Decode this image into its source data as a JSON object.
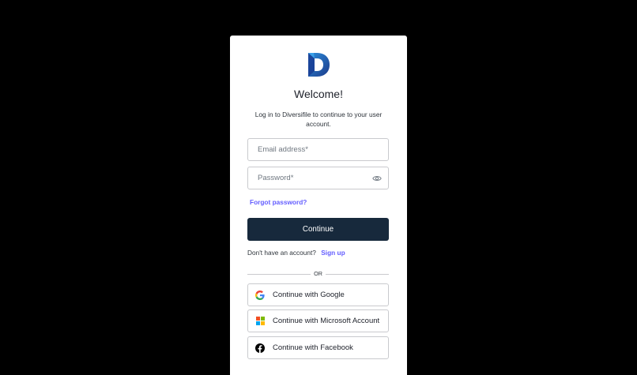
{
  "login": {
    "title": "Welcome!",
    "subtitle": "Log in to Diversifile to continue to your user account.",
    "email_placeholder": "Email address*",
    "password_placeholder": "Password*",
    "forgot_label": "Forgot password?",
    "continue_label": "Continue",
    "no_account_text": "Don't have an account?",
    "signup_label": "Sign up",
    "or_label": "OR",
    "social": [
      {
        "label": "Continue with Google",
        "icon": "google-icon"
      },
      {
        "label": "Continue with Microsoft Account",
        "icon": "microsoft-icon"
      },
      {
        "label": "Continue with Facebook",
        "icon": "facebook-icon"
      }
    ]
  },
  "colors": {
    "background": "#000000",
    "card": "#ffffff",
    "primary_button": "#17293c",
    "link": "#635dff",
    "border": "#c9cace",
    "logo_dark": "#1f3f8f",
    "logo_light": "#2a86d6"
  }
}
